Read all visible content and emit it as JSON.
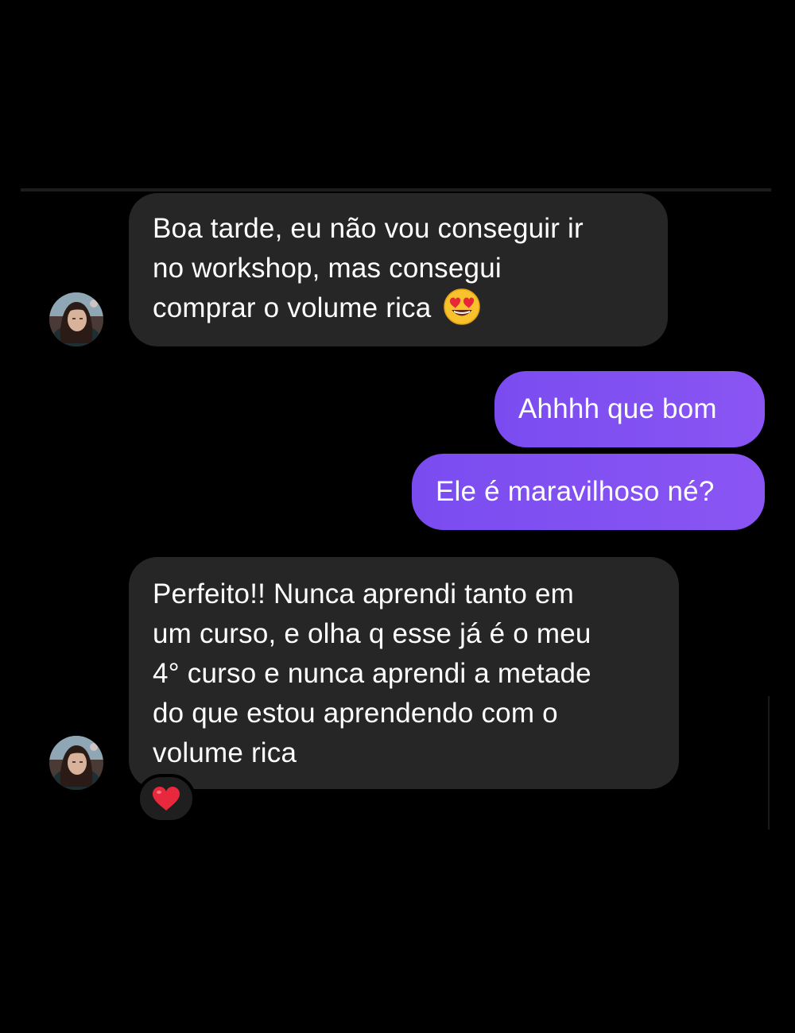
{
  "conversation": {
    "messages": [
      {
        "direction": "incoming",
        "lines": [
          "Boa tarde, eu não vou conseguir ir",
          "no workshop, mas consegui",
          "comprar o volume rica"
        ],
        "trailing_emoji": "smiling-face-with-heart-eyes"
      },
      {
        "direction": "outgoing",
        "text": "Ahhhh que bom"
      },
      {
        "direction": "outgoing",
        "text": "Ele é maravilhoso né?"
      },
      {
        "direction": "incoming",
        "lines": [
          "Perfeito!! Nunca aprendi tanto em",
          "um curso, e olha q esse já é o meu",
          "4° curso e nunca aprendi a metade",
          "do que estou aprendendo com o",
          "volume rica"
        ],
        "reaction": "red-heart"
      }
    ]
  },
  "colors": {
    "background": "#000000",
    "incoming_bubble": "#262626",
    "outgoing_bubble": "#7d4ef0",
    "text": "#ffffff"
  }
}
